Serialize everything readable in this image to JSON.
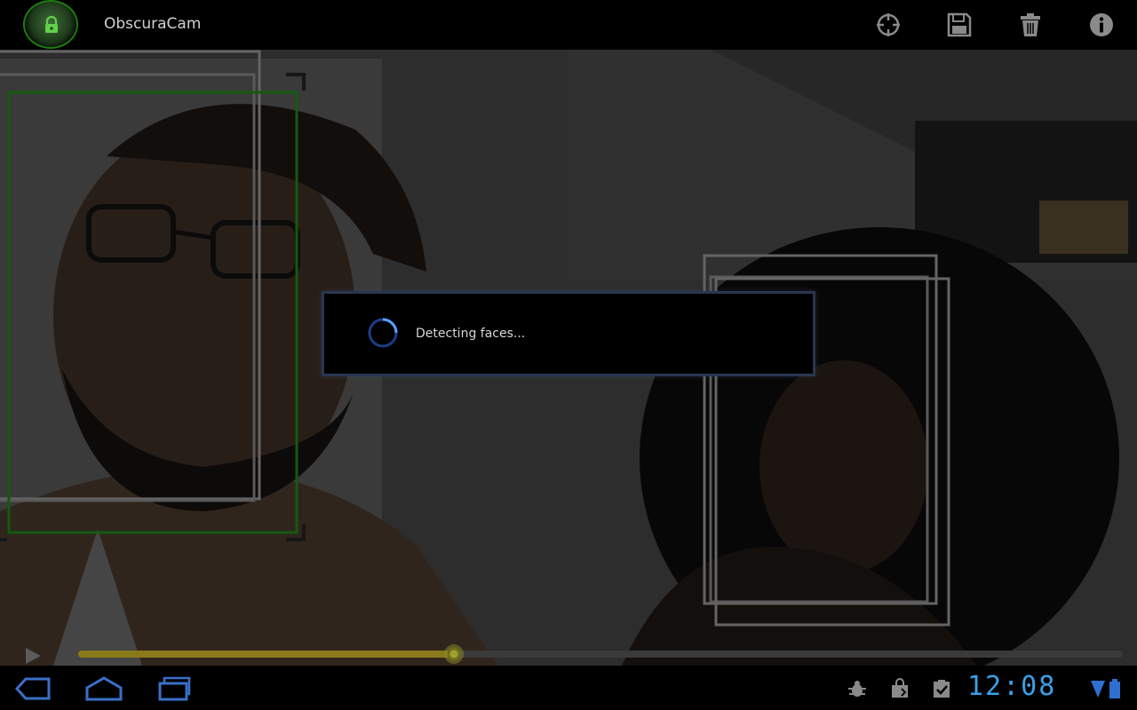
{
  "app": {
    "title": "ObscuraCam"
  },
  "action_bar": {
    "icons": [
      "crosshair-icon",
      "save-icon",
      "delete-icon",
      "info-icon"
    ]
  },
  "dialog": {
    "message": "Detecting faces..."
  },
  "playback": {
    "progress": 0.36
  },
  "status_bar": {
    "time": "12:08",
    "icons": [
      "debug-bug-icon",
      "store-bag-icon",
      "task-check-icon",
      "signal-icon",
      "battery-icon"
    ]
  },
  "colors": {
    "accent_blue": "#3aa0e8",
    "face_box_selected": "#1f8a1a",
    "face_box": "#9a9a9a",
    "seek_fill": "#8a7a1a"
  }
}
